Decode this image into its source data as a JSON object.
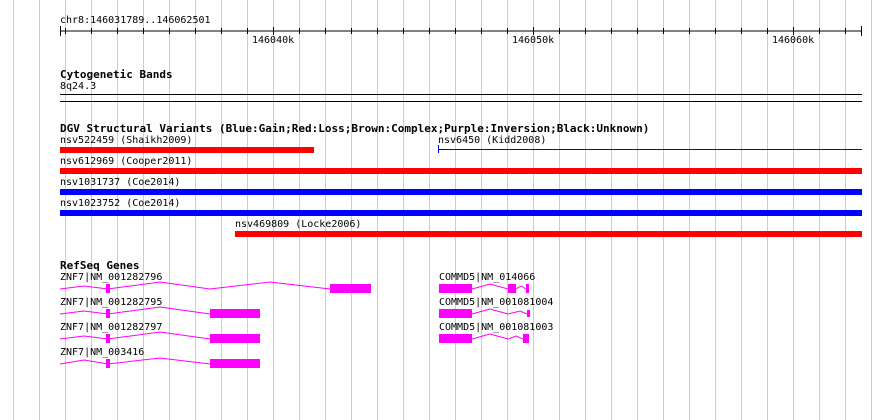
{
  "ruler": {
    "range": "chr8:146031789..146062501",
    "ticks": [
      "146040k",
      "146050k",
      "146060k"
    ]
  },
  "tracks": {
    "cytoband": {
      "title": "Cytogenetic Bands",
      "band": "8q24.3"
    },
    "dgv": {
      "title": "DGV Structural Variants (Blue:Gain;Red:Loss;Brown:Complex;Purple:Inversion;Black:Unknown)",
      "variants": [
        {
          "label": "nsv522459 (Shaikh2009)",
          "type": "Loss",
          "color": "#ff0000"
        },
        {
          "label": "nsv6450 (Kidd2008)",
          "type": "Gain",
          "color": "#0000ff"
        },
        {
          "label": "nsv612969 (Cooper2011)",
          "type": "Loss",
          "color": "#ff0000"
        },
        {
          "label": "nsv1031737 (Coe2014)",
          "type": "Gain",
          "color": "#0000ff"
        },
        {
          "label": "nsv1023752 (Coe2014)",
          "type": "Gain",
          "color": "#0000ff"
        },
        {
          "label": "nsv469809 (Locke2006)",
          "type": "Loss",
          "color": "#ff0000"
        }
      ]
    },
    "refseq": {
      "title": "RefSeq Genes",
      "gene_color": "#ff00ff",
      "genes": [
        {
          "label": "ZNF7|NM_001282796"
        },
        {
          "label": "ZNF7|NM_001282795"
        },
        {
          "label": "ZNF7|NM_001282797"
        },
        {
          "label": "ZNF7|NM_003416"
        },
        {
          "label": "COMMD5|NM_014066"
        },
        {
          "label": "COMMD5|NM_001081004"
        },
        {
          "label": "COMMD5|NM_001081003"
        }
      ]
    }
  },
  "colors": {
    "grid": "#add8e6"
  }
}
